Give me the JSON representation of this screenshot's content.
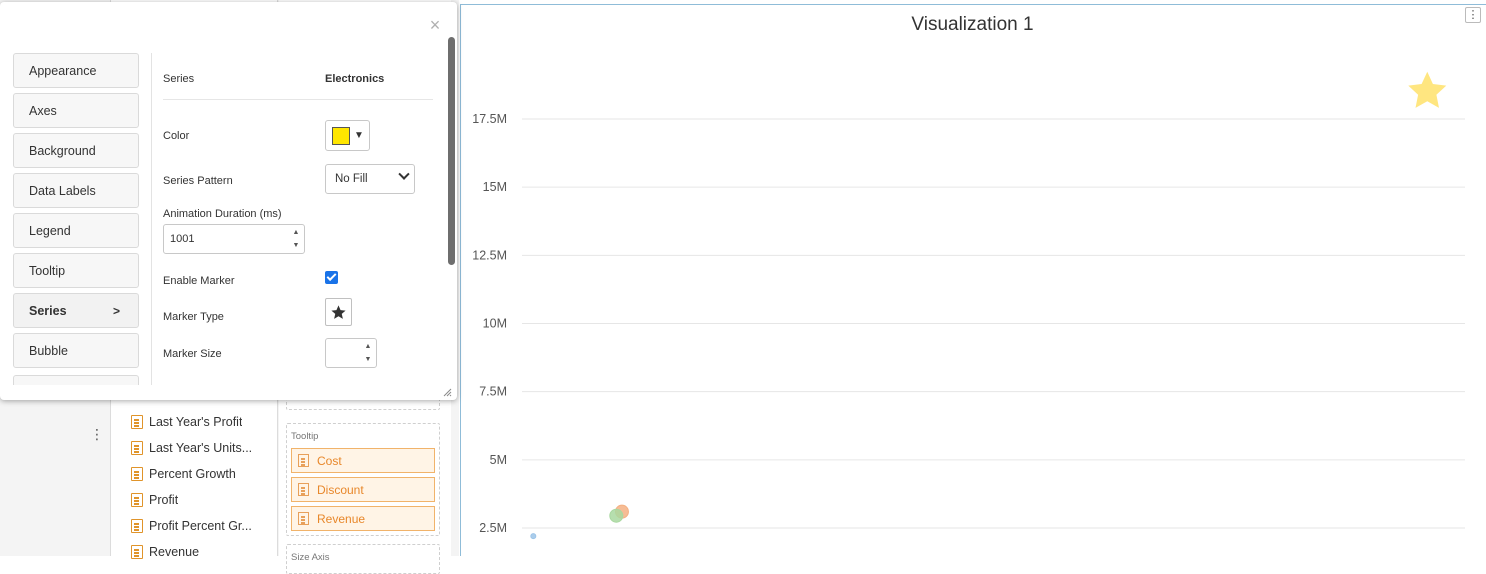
{
  "popup": {
    "close_label": "×",
    "menu": [
      {
        "label": "Appearance"
      },
      {
        "label": "Axes"
      },
      {
        "label": "Background"
      },
      {
        "label": "Data Labels"
      },
      {
        "label": "Legend"
      },
      {
        "label": "Tooltip"
      },
      {
        "label": "Series",
        "active": true,
        "arrow": ">"
      },
      {
        "label": "Bubble"
      }
    ],
    "properties": {
      "series_label": "Series",
      "series_value": "Electronics",
      "color_label": "Color",
      "color_value": "#ffe600",
      "color_caret": "▼",
      "pattern_label": "Series Pattern",
      "pattern_value": "No Fill",
      "duration_label": "Animation Duration (ms)",
      "duration_value": "1001",
      "enable_marker_label": "Enable Marker",
      "enable_marker_checked": true,
      "marker_type_label": "Marker Type",
      "marker_type_icon": "star-icon",
      "marker_size_label": "Marker Size",
      "marker_size_value": ""
    }
  },
  "fields": [
    {
      "label": "Last Year's Profit"
    },
    {
      "label": "Last Year's Units..."
    },
    {
      "label": "Percent Growth"
    },
    {
      "label": "Profit"
    },
    {
      "label": "Profit Percent Gr..."
    },
    {
      "label": "Revenue"
    }
  ],
  "wells": {
    "tooltip_title": "Tooltip",
    "tooltip_pills": [
      "Cost",
      "Discount",
      "Revenue"
    ],
    "next_title": "Size Axis"
  },
  "chart": {
    "title": "Visualization 1",
    "kebab": "⋮"
  },
  "chart_data": {
    "type": "scatter",
    "title": "Visualization 1",
    "y_ticks": [
      "17.5M",
      "15M",
      "12.5M",
      "10M",
      "7.5M",
      "5M",
      "2.5M"
    ],
    "y_tick_values": [
      17500000,
      15000000,
      12500000,
      10000000,
      7500000,
      5000000,
      2500000
    ],
    "ylim": [
      0,
      20000000
    ],
    "grid": true,
    "series": [
      {
        "color": "#ffe680",
        "marker": "star",
        "values": [
          {
            "x": 0.96,
            "y": 18500000
          }
        ]
      },
      {
        "color": "#f4b082",
        "marker": "circle",
        "values": [
          {
            "x": 0.106,
            "y": 3100000
          }
        ]
      },
      {
        "color": "#a9d8a0",
        "marker": "circle",
        "values": [
          {
            "x": 0.1,
            "y": 2950000
          }
        ]
      },
      {
        "color": "#9cc4e8",
        "marker": "circle",
        "values": [
          {
            "x": 0.012,
            "y": 2200000
          }
        ]
      }
    ],
    "colors": {
      "grid": "#e6e6e6",
      "tick_text": "#555555"
    }
  }
}
